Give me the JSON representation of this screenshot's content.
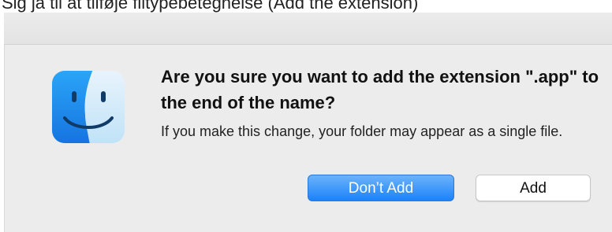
{
  "page_caption": "Sig ja til at tilføje filtypebetegnelse (Add the extension)",
  "dialog": {
    "title": "Are you sure you want to add the extension \".app\" to the end of the name?",
    "message": "If you make this change, your folder may appear as a single file.",
    "icon": "finder-icon",
    "buttons": {
      "primary_label": "Don’t Add",
      "secondary_label": "Add"
    }
  },
  "colors": {
    "dialog_bg": "#ececec",
    "primary_button": "#1a82fb",
    "finder_blue": "#1e8df3",
    "finder_light": "#6fc4fb"
  }
}
